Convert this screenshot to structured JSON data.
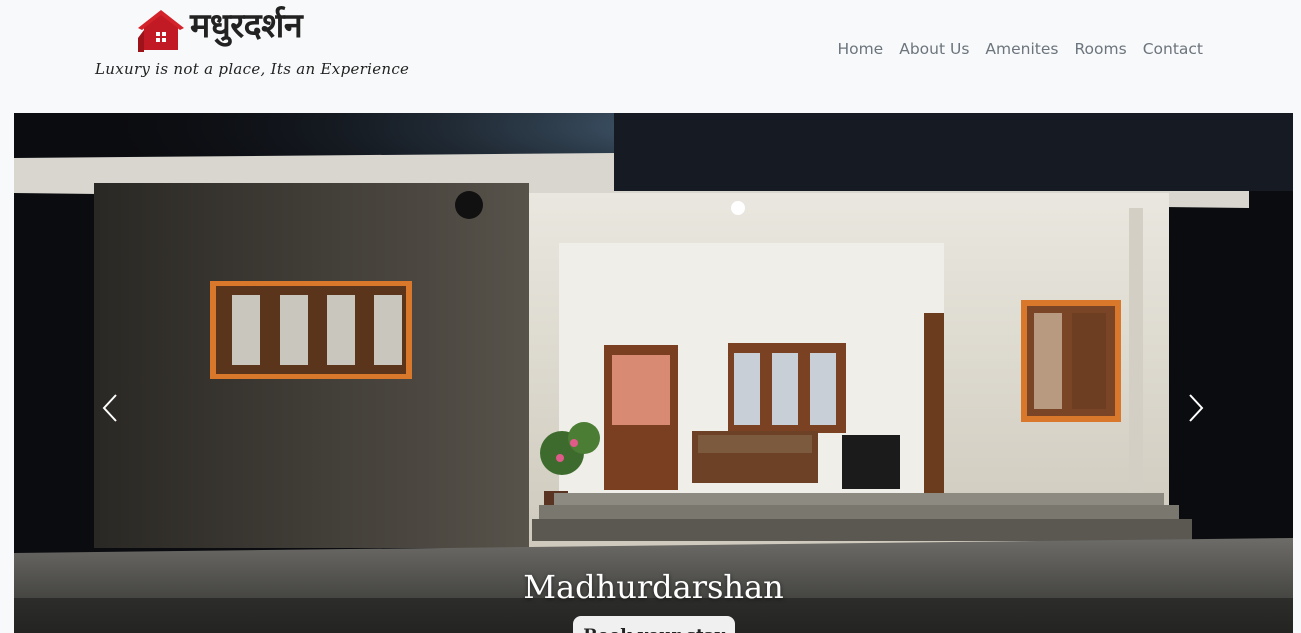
{
  "brand": {
    "name": "मधुरदर्शन",
    "tagline": "Luxury is not a place, Its an Experience",
    "logo_icon": "house-icon",
    "accent": "#d4222b"
  },
  "nav": {
    "items": [
      {
        "label": "Home"
      },
      {
        "label": "About Us"
      },
      {
        "label": "Amenites"
      },
      {
        "label": "Rooms"
      },
      {
        "label": "Contact"
      }
    ]
  },
  "hero": {
    "caption_title": "Madhurdarshan",
    "cta_label": "Book your stay",
    "prev_icon": "chevron-left-icon",
    "next_icon": "chevron-right-icon"
  }
}
